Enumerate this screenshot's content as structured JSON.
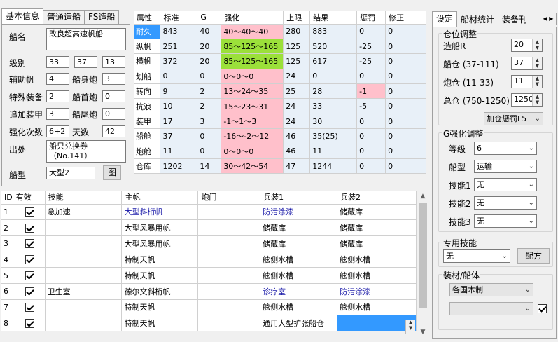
{
  "left_tabs": [
    "基本信息",
    "普通造船",
    "FS造船"
  ],
  "basic": {
    "ship_name_label": "船名",
    "ship_name": "改良超高速帆船",
    "level_label": "级别",
    "level": [
      "33",
      "37",
      "13"
    ],
    "aux_sail_label": "辅助帆",
    "aux_sail": "4",
    "body_gun_label": "船身炮",
    "body_gun": "3",
    "special_label": "特殊装备",
    "special": "2",
    "bow_gun_label": "船首炮",
    "bow_gun": "0",
    "armor_label": "追加装甲",
    "armor": "3",
    "stern_gun_label": "船尾炮",
    "stern_gun": "0",
    "enhance_label": "强化次数",
    "enhance": "6+2",
    "days_label": "天数",
    "days": "42",
    "origin_label": "出处",
    "origin": "船只兑换券（No.141）",
    "type_label": "船型",
    "type": "大型2",
    "type_btn": "图"
  },
  "attr_table": {
    "headers": [
      "属性",
      "标准",
      "G",
      "强化",
      "上限",
      "结果",
      "惩罚",
      "修正"
    ],
    "rows": [
      {
        "name": "耐久",
        "std": "843",
        "g": "40",
        "enh": "40～40～40",
        "cap": "280",
        "result": "883",
        "pen": "0",
        "fix": "0",
        "enh_color": "pink",
        "pen_color": "",
        "selected": true
      },
      {
        "name": "纵帆",
        "std": "251",
        "g": "20",
        "enh": "85～125～165",
        "cap": "125",
        "result": "520",
        "pen": "-25",
        "fix": "0",
        "enh_color": "green",
        "pen_color": "",
        "selected": false
      },
      {
        "name": "横帆",
        "std": "372",
        "g": "20",
        "enh": "85～125～165",
        "cap": "125",
        "result": "617",
        "pen": "-25",
        "fix": "0",
        "enh_color": "green",
        "pen_color": "",
        "selected": false
      },
      {
        "name": "划船",
        "std": "0",
        "g": "0",
        "enh": "0～0～0",
        "cap": "24",
        "result": "0",
        "pen": "0",
        "fix": "0",
        "enh_color": "pink",
        "pen_color": "",
        "selected": false
      },
      {
        "name": "转向",
        "std": "9",
        "g": "2",
        "enh": "13～24～35",
        "cap": "25",
        "result": "28",
        "pen": "-1",
        "fix": "0",
        "enh_color": "pink",
        "pen_color": "pink",
        "selected": false
      },
      {
        "name": "抗浪",
        "std": "10",
        "g": "2",
        "enh": "15～23～31",
        "cap": "24",
        "result": "33",
        "pen": "-5",
        "fix": "0",
        "enh_color": "pink",
        "pen_color": "",
        "selected": false
      },
      {
        "name": "装甲",
        "std": "17",
        "g": "3",
        "enh": "-1～1～3",
        "cap": "24",
        "result": "30",
        "pen": "0",
        "fix": "0",
        "enh_color": "pink",
        "pen_color": "",
        "selected": false
      },
      {
        "name": "船舱",
        "std": "37",
        "g": "0",
        "enh": "-16～-2～12",
        "cap": "46",
        "result": "35(25)",
        "pen": "0",
        "fix": "0",
        "enh_color": "pink",
        "pen_color": "",
        "selected": false
      },
      {
        "name": "炮舱",
        "std": "11",
        "g": "0",
        "enh": "0～0～0",
        "cap": "46",
        "result": "11",
        "pen": "0",
        "fix": "0",
        "enh_color": "pink",
        "pen_color": "",
        "selected": false
      },
      {
        "name": "仓库",
        "std": "1202",
        "g": "14",
        "enh": "30～42～54",
        "cap": "47",
        "result": "1244",
        "pen": "0",
        "fix": "0",
        "enh_color": "pink",
        "pen_color": "",
        "selected": false
      }
    ]
  },
  "skill_grid": {
    "headers": [
      "ID",
      "有效",
      "技能",
      "主帆",
      "炮门",
      "兵装1",
      "兵装2"
    ],
    "rows": [
      {
        "id": "1",
        "skill": "急加速",
        "main": "大型斜桁帆",
        "gun": "",
        "arm1": "防污涂漆",
        "arm2": "储藏库",
        "main_blue": true,
        "arm1_blue": true,
        "arm2_blue": false
      },
      {
        "id": "2",
        "skill": "",
        "main": "大型风暴用帆",
        "gun": "",
        "arm1": "储藏库",
        "arm2": "储藏库",
        "main_blue": false,
        "arm1_blue": false,
        "arm2_blue": false
      },
      {
        "id": "3",
        "skill": "",
        "main": "大型风暴用帆",
        "gun": "",
        "arm1": "储藏库",
        "arm2": "储藏库",
        "main_blue": false,
        "arm1_blue": false,
        "arm2_blue": false
      },
      {
        "id": "4",
        "skill": "",
        "main": "特制天帆",
        "gun": "",
        "arm1": "舷侧水槽",
        "arm2": "舷侧水槽",
        "main_blue": false,
        "arm1_blue": false,
        "arm2_blue": false
      },
      {
        "id": "5",
        "skill": "",
        "main": "特制天帆",
        "gun": "",
        "arm1": "舷侧水槽",
        "arm2": "舷侧水槽",
        "main_blue": false,
        "arm1_blue": false,
        "arm2_blue": false
      },
      {
        "id": "6",
        "skill": "卫生室",
        "main": "德尔文斜桁帆",
        "gun": "",
        "arm1": "诊疗室",
        "arm2": "防污涂漆",
        "main_blue": false,
        "arm1_blue": true,
        "arm2_blue": true
      },
      {
        "id": "7",
        "skill": "",
        "main": "特制天帆",
        "gun": "",
        "arm1": "舷侧水槽",
        "arm2": "舷侧水槽",
        "main_blue": false,
        "arm1_blue": false,
        "arm2_blue": false
      },
      {
        "id": "8",
        "skill": "",
        "main": "特制天帆",
        "gun": "",
        "arm1": "通用大型扩张船仓",
        "arm2": "",
        "main_blue": false,
        "arm1_blue": false,
        "arm2_blue": false
      }
    ]
  },
  "right_tabs": [
    "设定",
    "船材统计",
    "装备刊"
  ],
  "settings": {
    "cabin_group": "仓位调整",
    "shipbuild_r_label": "造船R",
    "shipbuild_r": "20",
    "cabin_label": "船仓 (37-111)",
    "cabin": "37",
    "gun_cabin_label": "炮仓 (11-33)",
    "gun_cabin": "11",
    "total_label": "总仓 (750-1250)",
    "total": "1250",
    "penalty_combo": "加仓惩罚L5",
    "g_group": "G强化调整",
    "grade_label": "等级",
    "grade": "6",
    "shiptype_label": "船型",
    "shiptype": "运输",
    "skill1_label": "技能1",
    "skill1": "无",
    "skill2_label": "技能2",
    "skill2": "无",
    "skill3_label": "技能3",
    "skill3": "无",
    "special_group": "专用技能",
    "special_value": "无",
    "recipe_btn": "配方",
    "material_group": "装材/船体",
    "material": "各国木制",
    "hull": ""
  }
}
